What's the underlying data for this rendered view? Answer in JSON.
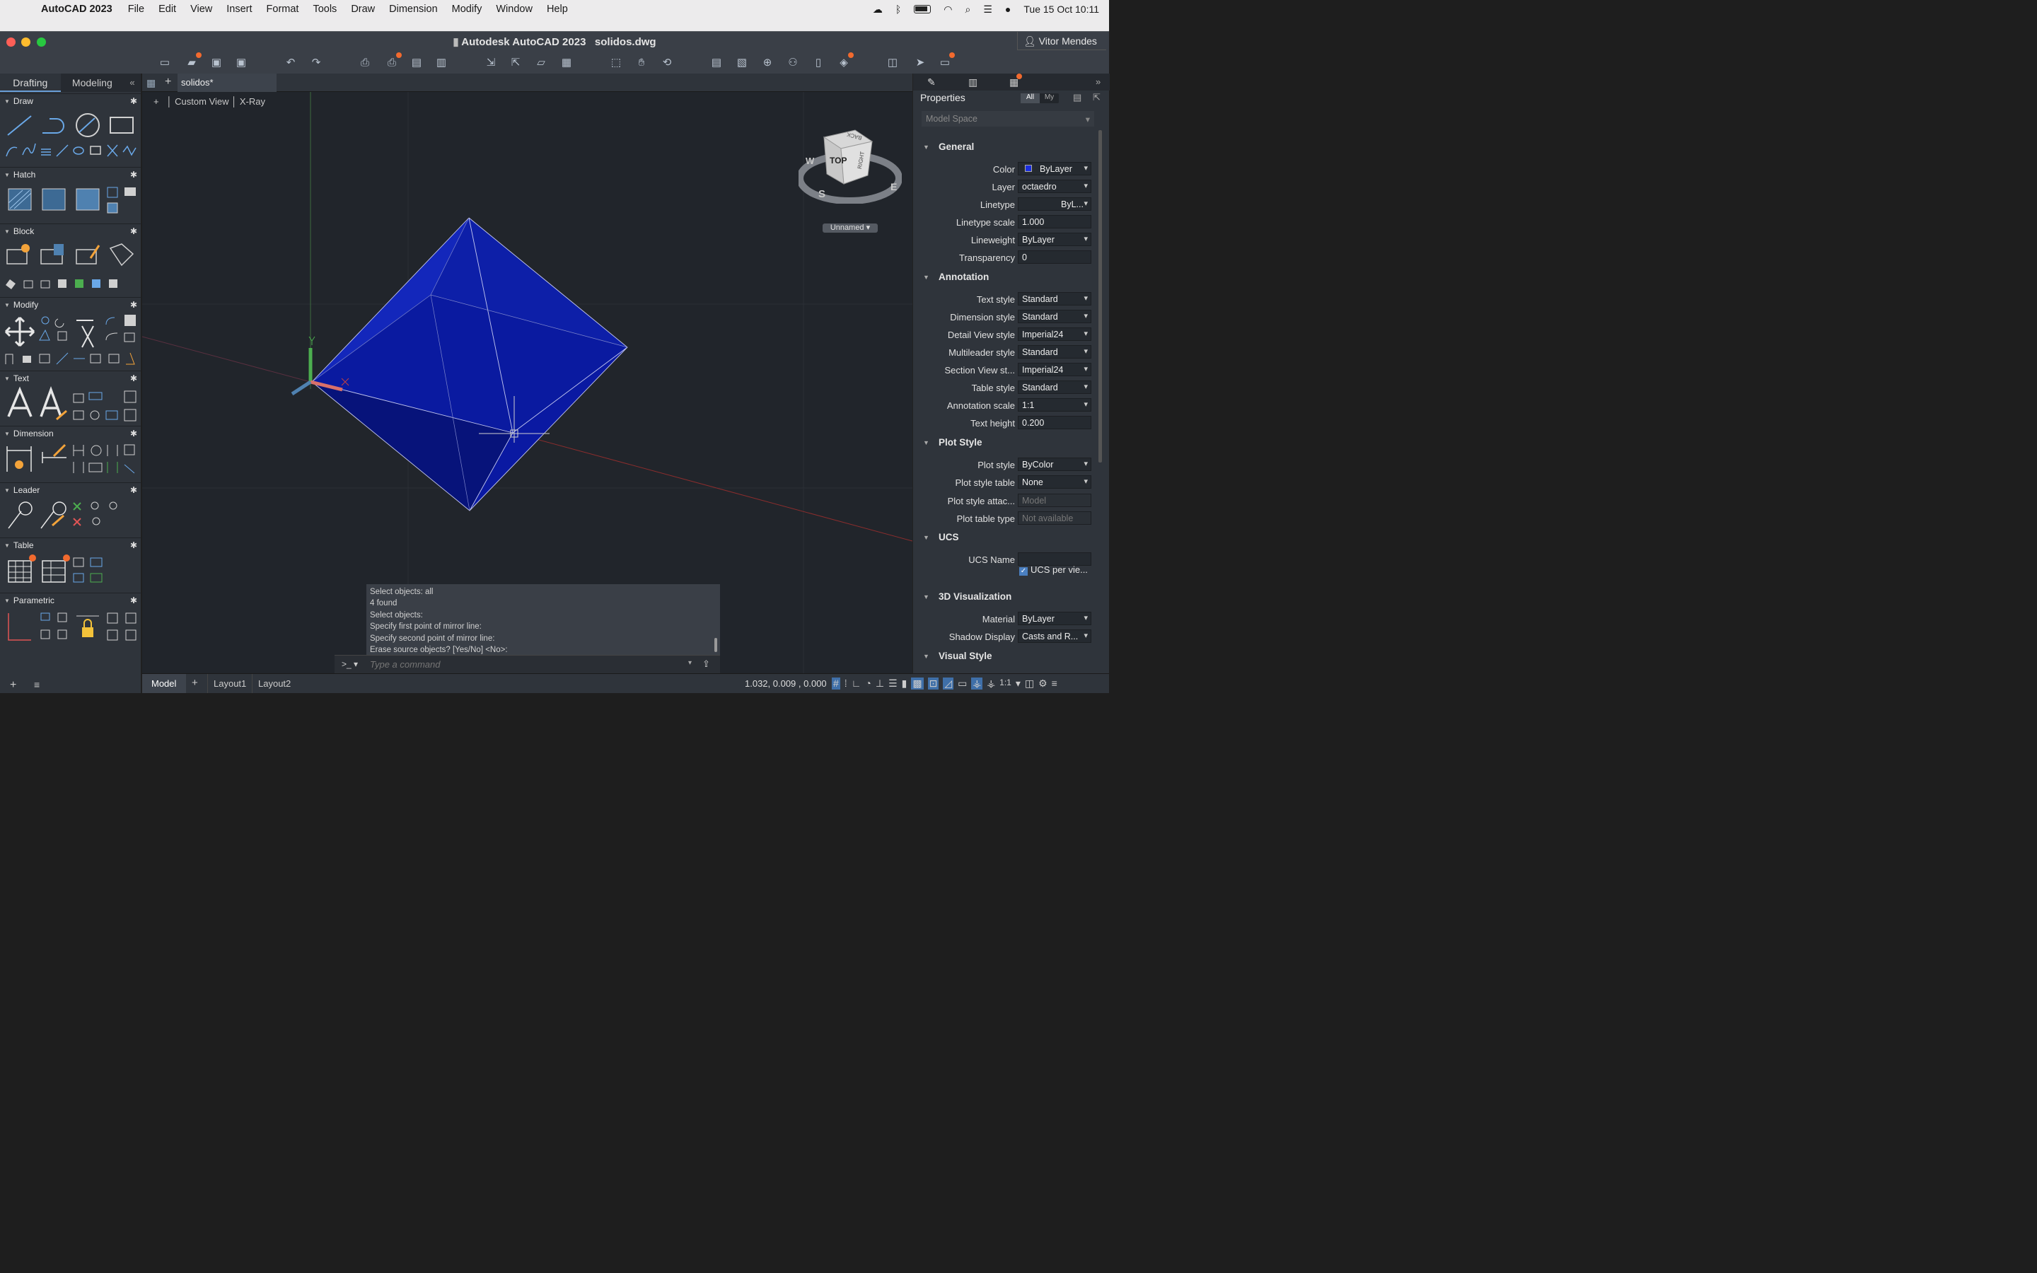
{
  "menubar": {
    "app": "AutoCAD 2023",
    "items": [
      "File",
      "Edit",
      "View",
      "Insert",
      "Format",
      "Tools",
      "Draw",
      "Dimension",
      "Modify",
      "Window",
      "Help"
    ],
    "datetime": "Tue 15 Oct  10:11"
  },
  "window": {
    "app_title": "Autodesk AutoCAD 2023",
    "file": "solidos.dwg",
    "user": "Vitor Mendes"
  },
  "left_tabs": {
    "drafting": "Drafting",
    "modeling": "Modeling"
  },
  "tool_sections": [
    "Draw",
    "Hatch",
    "Block",
    "Modify",
    "Text",
    "Dimension",
    "Leader",
    "Table",
    "Parametric"
  ],
  "doc_tab": "solidos*",
  "viewport": {
    "label_a": "Custom View",
    "label_b": "X-Ray",
    "viewcube_top": "TOP",
    "viewcube_right": "RIGHT",
    "viewcube_back": "BACK",
    "compass_w": "W",
    "compass_s": "S",
    "compass_e": "E",
    "ucs_name": "Unnamed"
  },
  "command_history": [
    "Select objects: all",
    "4 found",
    "Select objects:",
    "Specify first point of mirror line:",
    "Specify second point of mirror line:",
    "Erase source objects? [Yes/No] <No>:"
  ],
  "command_placeholder": "Type a command",
  "status": {
    "model": "Model",
    "layout1": "Layout1",
    "layout2": "Layout2",
    "coords": "1.032,  0.009 , 0.000",
    "scale": "1:1"
  },
  "properties": {
    "title": "Properties",
    "filter_all": "All",
    "filter_my": "My",
    "selection": "Model Space",
    "sections": {
      "general": "General",
      "annotation": "Annotation",
      "plot": "Plot Style",
      "ucs": "UCS",
      "viz3d": "3D Visualization",
      "visual": "Visual Style"
    },
    "general": [
      [
        "Color",
        "ByLayer"
      ],
      [
        "Layer",
        "octaedro"
      ],
      [
        "Linetype",
        "ByL..."
      ],
      [
        "Linetype scale",
        "1.000"
      ],
      [
        "Lineweight",
        "ByLayer"
      ],
      [
        "Transparency",
        "0"
      ]
    ],
    "annotation": [
      [
        "Text style",
        "Standard"
      ],
      [
        "Dimension style",
        "Standard"
      ],
      [
        "Detail View style",
        "Imperial24"
      ],
      [
        "Multileader style",
        "Standard"
      ],
      [
        "Section View st...",
        "Imperial24"
      ],
      [
        "Table style",
        "Standard"
      ],
      [
        "Annotation scale",
        "1:1"
      ],
      [
        "Text height",
        "0.200"
      ]
    ],
    "plot": [
      [
        "Plot style",
        "ByColor"
      ],
      [
        "Plot style table",
        "None"
      ],
      [
        "Plot style attac...",
        "Model"
      ],
      [
        "Plot table type",
        "Not available"
      ]
    ],
    "ucs": [
      [
        "UCS Name",
        ""
      ]
    ],
    "ucs_per_view": "UCS per vie...",
    "viz3d": [
      [
        "Material",
        "ByLayer"
      ],
      [
        "Shadow Display",
        "Casts and R..."
      ]
    ]
  },
  "colors": {
    "octahedron": "#0a1aa8",
    "accent": "#f26a2e",
    "panel": "#2f343b"
  }
}
